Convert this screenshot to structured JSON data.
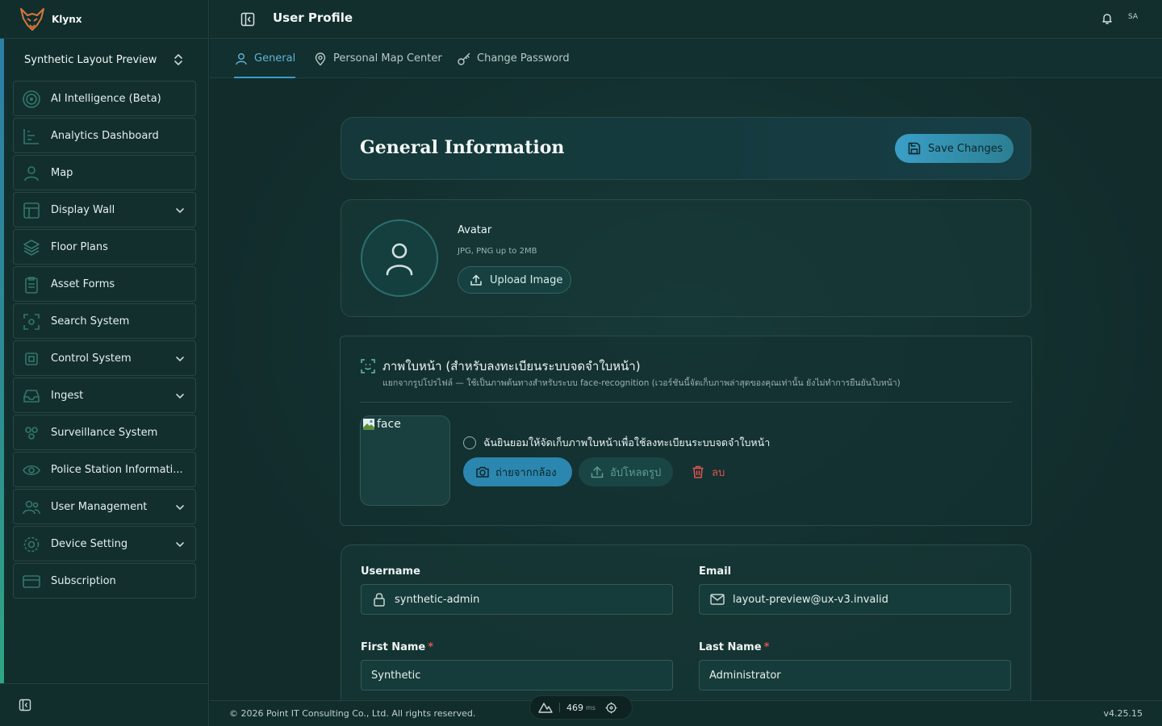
{
  "app": {
    "name": "Klynx",
    "workspace": "Synthetic Layout Preview"
  },
  "sidebar": {
    "items": [
      {
        "label": "AI Intelligence (Beta)",
        "icon": "target-icon",
        "expandable": false
      },
      {
        "label": "Analytics Dashboard",
        "icon": "chart-icon",
        "expandable": false
      },
      {
        "label": "Map",
        "icon": "user-pin-icon",
        "expandable": false
      },
      {
        "label": "Display Wall",
        "icon": "grid-icon",
        "expandable": true
      },
      {
        "label": "Floor Plans",
        "icon": "layers-icon",
        "expandable": false
      },
      {
        "label": "Asset Forms",
        "icon": "clipboard-icon",
        "expandable": false
      },
      {
        "label": "Search System",
        "icon": "scan-icon",
        "expandable": false
      },
      {
        "label": "Control System",
        "icon": "cpu-icon",
        "expandable": true
      },
      {
        "label": "Ingest",
        "icon": "inbox-icon",
        "expandable": true
      },
      {
        "label": "Surveillance System",
        "icon": "cameras-icon",
        "expandable": false
      },
      {
        "label": "Police Station Informati...",
        "icon": "eye-icon",
        "expandable": false
      },
      {
        "label": "User Management",
        "icon": "users-icon",
        "expandable": true
      },
      {
        "label": "Device Setting",
        "icon": "gear-icon",
        "expandable": true
      },
      {
        "label": "Subscription",
        "icon": "card-icon",
        "expandable": false
      }
    ]
  },
  "header": {
    "title": "User Profile",
    "user_initials": "SA"
  },
  "tabs": [
    {
      "label": "General",
      "active": true
    },
    {
      "label": "Personal Map Center",
      "active": false
    },
    {
      "label": "Change Password",
      "active": false
    }
  ],
  "general": {
    "title": "General Information",
    "save_label": "Save Changes"
  },
  "avatar": {
    "label": "Avatar",
    "hint": "JPG, PNG up to 2MB",
    "upload_label": "Upload Image"
  },
  "face": {
    "title": "ภาพใบหน้า (สำหรับลงทะเบียนระบบจดจำใบหน้า)",
    "subtitle": "แยกจากรูปโปรไฟล์ — ใช้เป็นภาพต้นทางสำหรับระบบ face-recognition (เวอร์ชันนี้จัดเก็บภาพล่าสุดของคุณเท่านั้น ยังไม่ทำการยืนยันใบหน้า)",
    "image_alt": "face",
    "consent_label": "ฉันยินยอมให้จัดเก็บภาพใบหน้าเพื่อใช้ลงทะเบียนระบบจดจำใบหน้า",
    "consent_checked": false,
    "camera_label": "ถ่ายจากกล้อง",
    "upload_label": "อัปโหลดรูป",
    "delete_label": "ลบ"
  },
  "form": {
    "username": {
      "label": "Username",
      "value": "synthetic-admin"
    },
    "email": {
      "label": "Email",
      "value": "layout-preview@ux-v3.invalid"
    },
    "first_name": {
      "label": "First Name",
      "value": "Synthetic",
      "required": true
    },
    "last_name": {
      "label": "Last Name",
      "value": "Administrator",
      "required": true
    }
  },
  "footer": {
    "copyright": "© 2026 Point IT Consulting Co., Ltd. All rights reserved.",
    "version": "v4.25.15",
    "latency_value": "469",
    "latency_unit": "ms"
  },
  "colors": {
    "accent": "#3b9cc9",
    "danger": "#e0544d",
    "background": "#0e2a2a"
  }
}
